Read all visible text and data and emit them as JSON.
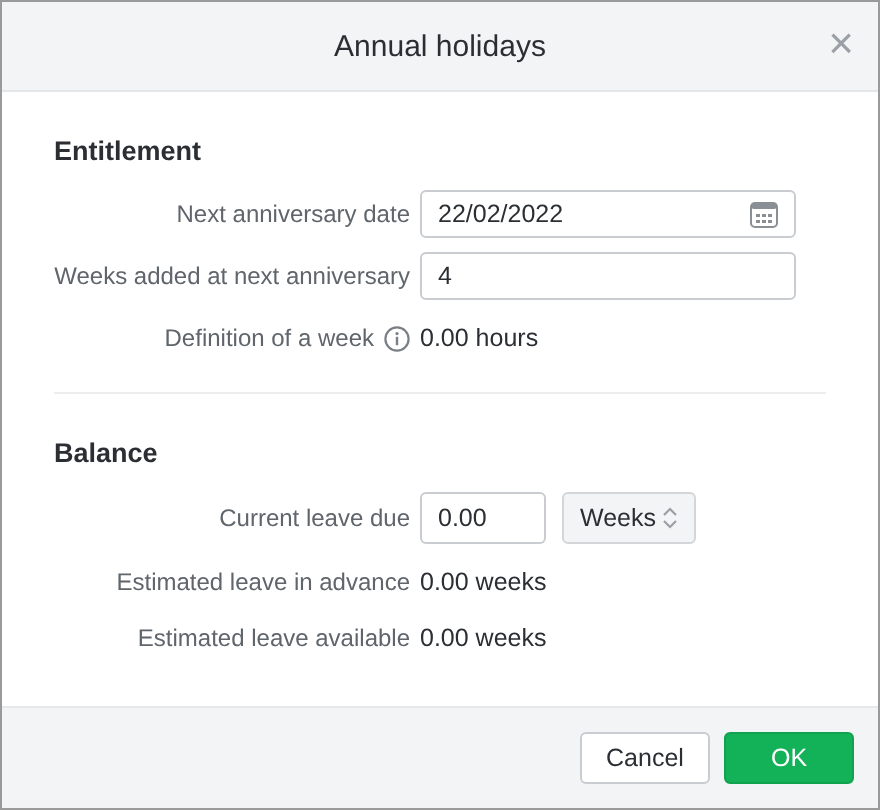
{
  "window": {
    "title": "Annual holidays",
    "close": "×"
  },
  "sections": [
    {
      "title": "Entitlement",
      "rows": [
        {
          "kind": "date",
          "label": "Next anniversary date",
          "value": "22/02/2022"
        },
        {
          "kind": "input",
          "label": "Weeks added at next anniversary",
          "value": "4"
        },
        {
          "kind": "info",
          "label": "Definition of a week",
          "value": "0.00 hours"
        }
      ]
    },
    {
      "title": "Balance",
      "rows": [
        {
          "kind": "input-select",
          "label": "Current leave due",
          "value": "0.00",
          "unit": "Weeks"
        },
        {
          "kind": "readout",
          "label": "Estimated leave in advance",
          "value": "0.00 weeks"
        },
        {
          "kind": "readout",
          "label": "Estimated leave available",
          "value": "0.00 weeks"
        }
      ]
    }
  ],
  "buttons": [
    {
      "label": "Cancel",
      "kind": "secondary"
    },
    {
      "label": "OK",
      "kind": "primary"
    }
  ]
}
